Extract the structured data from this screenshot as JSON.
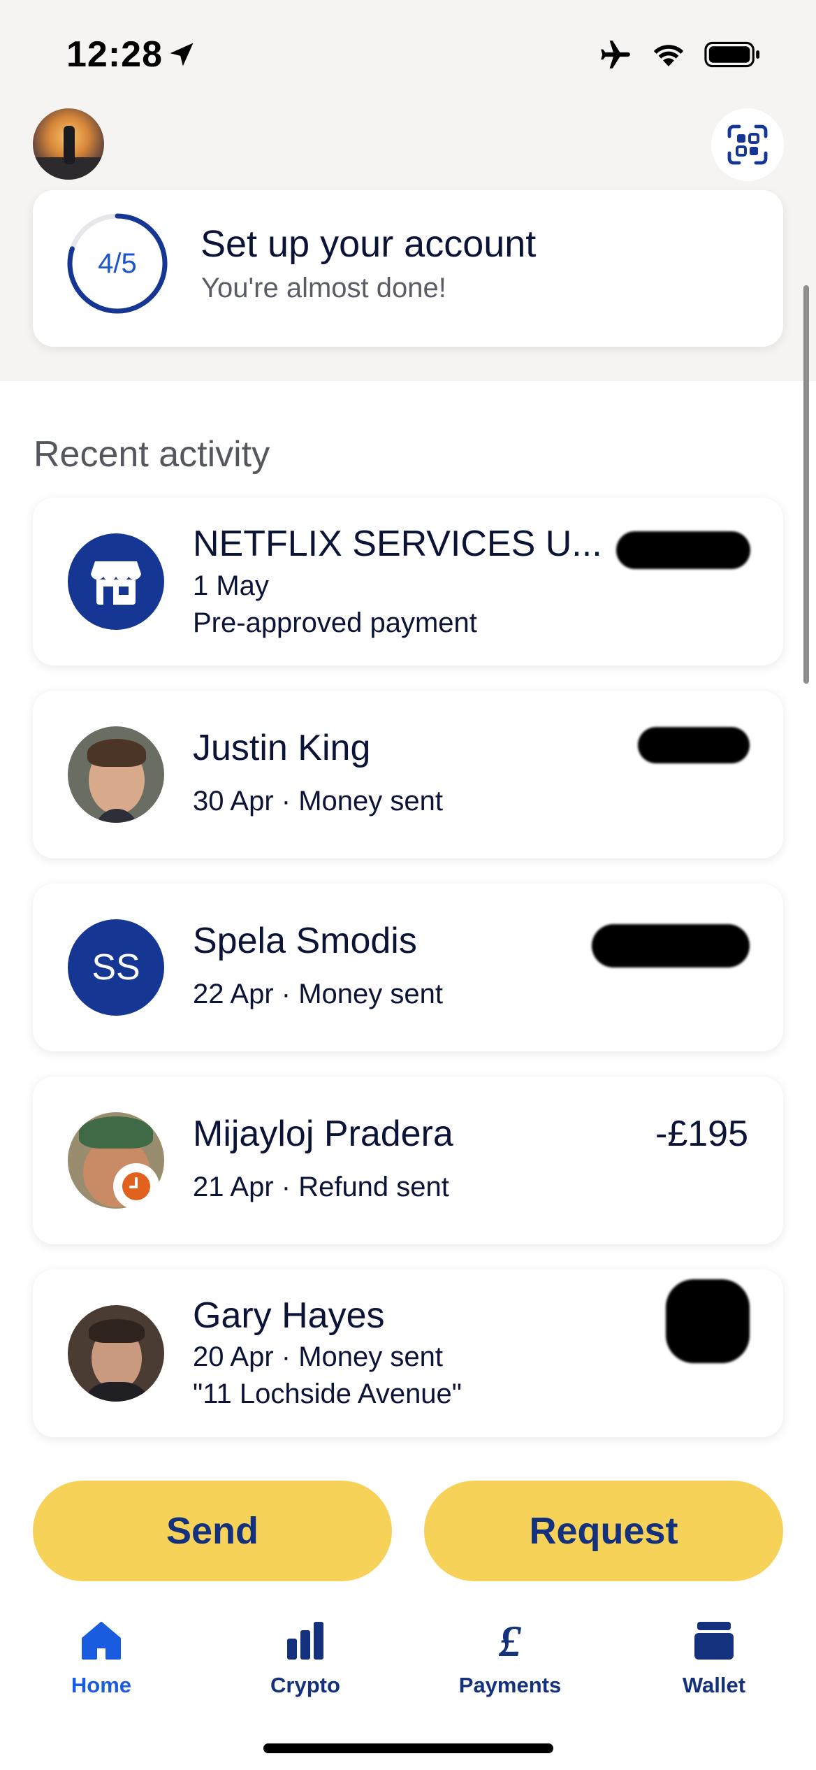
{
  "status_bar": {
    "time": "12:28",
    "icons": [
      "location-arrow-icon",
      "airplane-icon",
      "wifi-icon",
      "battery-icon"
    ]
  },
  "header": {
    "profile_avatar": "profile-avatar",
    "scan_icon": "qr-scan-icon"
  },
  "setup_card": {
    "progress": "4/5",
    "progress_fraction": 0.8,
    "title": "Set up your account",
    "subtitle": "You're almost done!"
  },
  "activity": {
    "section_title": "Recent activity",
    "items": [
      {
        "name": "NETFLIX SERVICES U...",
        "date": "1 May",
        "detail": "Pre-approved payment",
        "amount": "",
        "amount_redacted": true,
        "avatar": "store-icon"
      },
      {
        "name": "Justin King",
        "line": "30 Apr · Money sent",
        "amount": "",
        "amount_redacted": true,
        "avatar": "photo"
      },
      {
        "name": "Spela Smodis",
        "line": "22 Apr · Money sent",
        "amount": "",
        "amount_redacted": true,
        "avatar_initials": "SS"
      },
      {
        "name": "Mijayloj Pradera",
        "line": "21 Apr · Refund sent",
        "amount": "-£195",
        "avatar": "photo",
        "badge": "clock-icon"
      },
      {
        "name": "Gary Hayes",
        "line": "20 Apr · Money sent",
        "note": "\"11 Lochside Avenue\"",
        "amount": "",
        "amount_redacted": true,
        "avatar": "photo"
      }
    ]
  },
  "actions": {
    "send": "Send",
    "request": "Request"
  },
  "tabs": [
    {
      "label": "Home",
      "icon": "home-icon",
      "active": true
    },
    {
      "label": "Crypto",
      "icon": "bar-chart-icon",
      "active": false
    },
    {
      "label": "Payments",
      "icon": "pound-icon",
      "active": false
    },
    {
      "label": "Wallet",
      "icon": "wallet-icon",
      "active": false
    }
  ],
  "colors": {
    "navy": "#0b1437",
    "brand_blue": "#163694",
    "accent_blue": "#1a5ce0",
    "button_yellow": "#f6d258",
    "top_bg": "#f5f4f2"
  }
}
